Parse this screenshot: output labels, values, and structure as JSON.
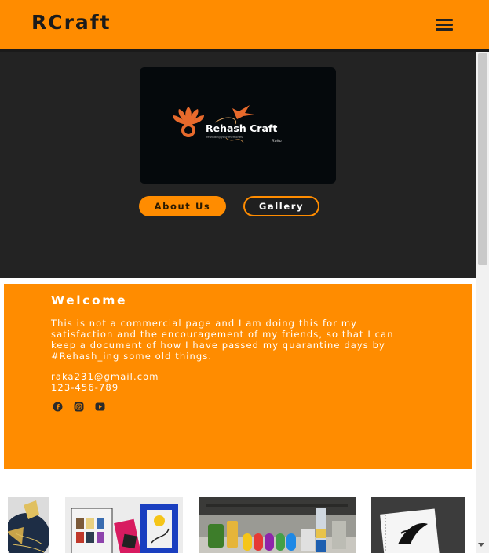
{
  "header": {
    "brand": "RCraft",
    "menu_icon": "hamburger-menu-icon"
  },
  "hero": {
    "logo": {
      "icon": "rehash-craft-logo-icon",
      "text": "Rehash Craft",
      "tagline": "rewinding your memories",
      "signature": "Raka"
    },
    "buttons": {
      "about_label": "About Us",
      "gallery_label": "Gallery"
    }
  },
  "welcome": {
    "title": "Welcome",
    "body": "This is not a commercial page and I am doing this for my satisfaction and the encouragement of my friends, so that I can keep a document of how I have passed my quarantine days by #Rehash_ing some old things.",
    "email": "raka231@gmail.com",
    "phone": "123-456-789",
    "social_icons": [
      "facebook-icon",
      "instagram-icon",
      "youtube-icon"
    ]
  },
  "gallery": {
    "items": [
      {
        "icon": "craft-photo-blue-gold-icon"
      },
      {
        "icon": "craft-photo-painted-frames-icon"
      },
      {
        "icon": "craft-photo-colored-bottles-icon"
      },
      {
        "icon": "craft-photo-sketchbook-icon"
      }
    ]
  },
  "colors": {
    "accent": "#ff8c00",
    "hero_bg": "#232323",
    "text_dark": "#1b1b1b",
    "text_light": "#ffffff"
  }
}
